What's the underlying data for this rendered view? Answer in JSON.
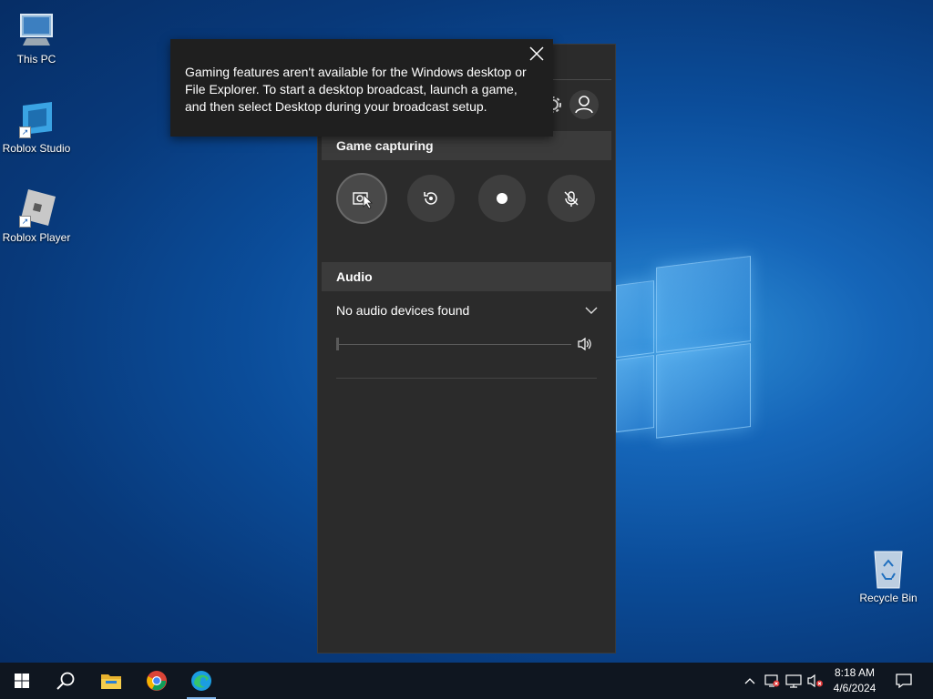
{
  "desktop": {
    "icons": [
      {
        "label": "This PC",
        "icon": "this-pc-icon"
      },
      {
        "label": "Roblox Studio",
        "icon": "roblox-studio-icon"
      },
      {
        "label": "Roblox Player",
        "icon": "roblox-player-icon"
      },
      {
        "label": "Recycle Bin",
        "icon": "recycle-bin-icon"
      }
    ]
  },
  "gamebar": {
    "capture_section": {
      "title": "Game capturing",
      "buttons": [
        {
          "icon": "screenshot-icon",
          "active": true
        },
        {
          "icon": "record-last-icon",
          "active": false
        },
        {
          "icon": "record-dot-icon",
          "active": false
        },
        {
          "icon": "mic-off-icon",
          "active": false
        }
      ]
    },
    "audio_section": {
      "title": "Audio",
      "device": "No audio devices found",
      "volume_level": 0
    }
  },
  "toast": {
    "message": "Gaming features aren't available for the Windows desktop or File Explorer. To start a desktop broadcast, launch a game, and then select Desktop during your broadcast setup."
  },
  "taskbar": {
    "apps": [
      "start-icon",
      "search-icon",
      "file-explorer-icon",
      "chrome-icon",
      "edge-icon"
    ],
    "tray": [
      "chevron-up-icon",
      "network-alert-icon",
      "display-icon",
      "speaker-muted-icon"
    ],
    "clock": {
      "time": "8:18 AM",
      "date": "4/6/2024"
    }
  },
  "colors": {
    "panel_bg": "#2b2b2b",
    "section_header_bg": "#3b3b3b",
    "toast_bg": "#1f1f1f",
    "taskbar_bg": "#0f1620"
  }
}
